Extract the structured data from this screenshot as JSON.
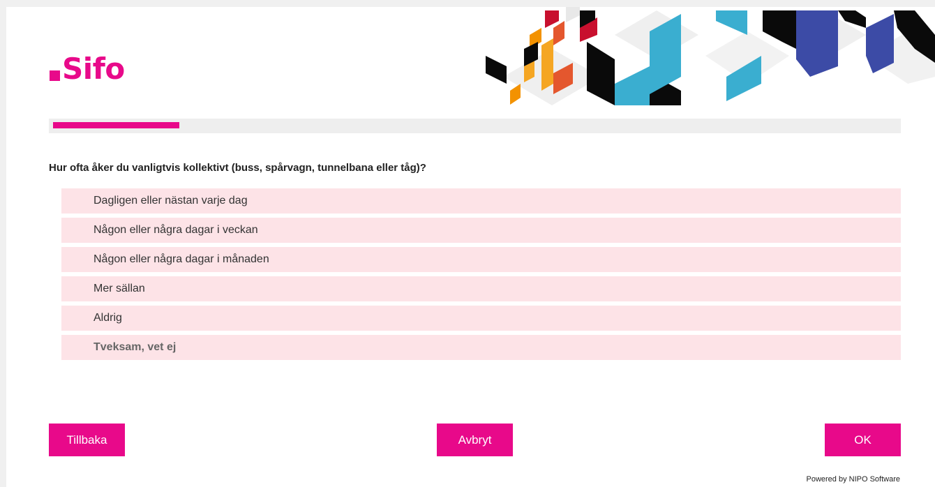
{
  "brand": {
    "logo_text": "Sifo",
    "accent_color": "#e8098a",
    "option_bg": "#fde3e7"
  },
  "progress": {
    "fraction": 0.15
  },
  "question": {
    "text": "Hur ofta åker du vanligtvis kollektivt (buss, spårvagn, tunnelbana eller tåg)?",
    "options": [
      "Dagligen eller nästan varje dag",
      "Någon eller några dagar i veckan",
      "Någon eller några dagar i månaden",
      "Mer sällan",
      "Aldrig",
      "Tveksam, vet ej"
    ]
  },
  "buttons": {
    "back": "Tillbaka",
    "cancel": "Avbryt",
    "ok": "OK"
  },
  "footer": {
    "powered_by": "Powered by NIPO Software"
  }
}
